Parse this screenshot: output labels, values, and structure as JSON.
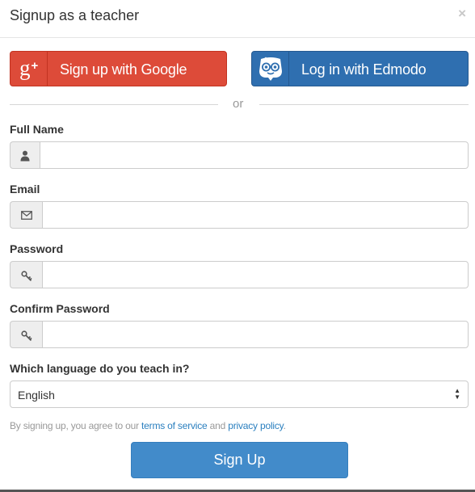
{
  "modal": {
    "title": "Signup as a teacher",
    "close_glyph": "×"
  },
  "social": {
    "google_label": "Sign up with Google",
    "google_icon": "google-plus-icon",
    "google_icon_text": "g",
    "google_icon_sup": "+",
    "edmodo_label": "Log in with Edmodo",
    "edmodo_icon": "edmodo-logo-icon"
  },
  "divider": {
    "text": "or"
  },
  "form": {
    "full_name": {
      "label": "Full Name",
      "value": "",
      "icon": "user-icon"
    },
    "email": {
      "label": "Email",
      "value": "",
      "icon": "envelope-icon"
    },
    "password": {
      "label": "Password",
      "value": "",
      "icon": "key-icon"
    },
    "confirm_password": {
      "label": "Confirm Password",
      "value": "",
      "icon": "key-icon"
    },
    "language": {
      "label": "Which language do you teach in?",
      "selected": "English"
    }
  },
  "terms": {
    "prefix": "By signing up, you agree to our ",
    "tos_link": "terms of service",
    "and_text": " and ",
    "privacy_link": "privacy policy",
    "suffix": "."
  },
  "submit": {
    "label": "Sign Up"
  },
  "colors": {
    "google": "#dd4b39",
    "edmodo": "#2f6fb0",
    "primary": "#428bca",
    "link": "#2a7fbf"
  }
}
